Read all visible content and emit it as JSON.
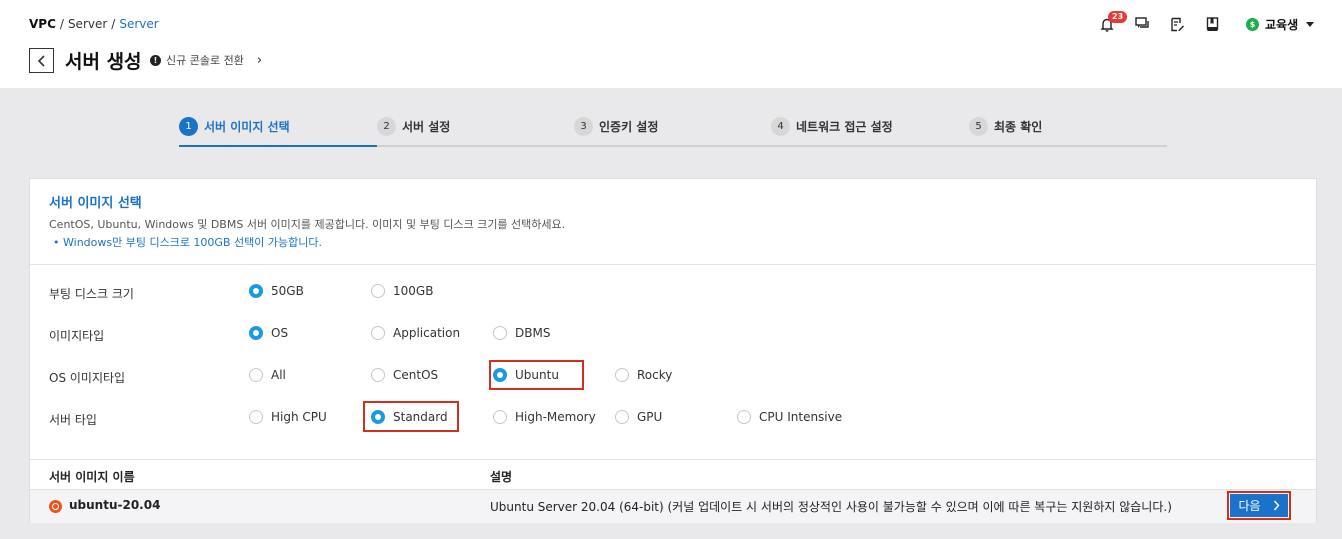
{
  "breadcrumb": [
    "VPC",
    "Server",
    "Server"
  ],
  "header": {
    "title": "서버 생성",
    "switch_console": "신규 콘솔로 전환",
    "notification_count": "23",
    "user_name": "교육생",
    "user_coin": "$"
  },
  "steps": [
    {
      "num": "1",
      "label": "서버 이미지 선택"
    },
    {
      "num": "2",
      "label": "서버 설정"
    },
    {
      "num": "3",
      "label": "인증키 설정"
    },
    {
      "num": "4",
      "label": "네트워크 접근 설정"
    },
    {
      "num": "5",
      "label": "최종 확인"
    }
  ],
  "section": {
    "title": "서버 이미지 선택",
    "description": "CentOS, Ubuntu, Windows 및 DBMS 서버 이미지를 제공합니다. 이미지 및 부팅 디스크 크기를 선택하세요.",
    "note": "Windows만 부팅 디스크로 100GB 선택이 가능합니다."
  },
  "form": {
    "boot_disk": {
      "label": "부팅 디스크 크기",
      "options": [
        "50GB",
        "100GB"
      ],
      "selected": "50GB"
    },
    "image_type": {
      "label": "이미지타입",
      "options": [
        "OS",
        "Application",
        "DBMS"
      ],
      "selected": "OS"
    },
    "os_image_type": {
      "label": "OS 이미지타입",
      "options": [
        "All",
        "CentOS",
        "Ubuntu",
        "Rocky"
      ],
      "selected": "Ubuntu"
    },
    "server_type": {
      "label": "서버 타입",
      "options": [
        "High CPU",
        "Standard",
        "High-Memory",
        "GPU",
        "CPU Intensive"
      ],
      "selected": "Standard"
    }
  },
  "table": {
    "headers": [
      "서버 이미지 이름",
      "설명"
    ],
    "rows": [
      {
        "name": "ubuntu-20.04",
        "description": "Ubuntu Server 20.04 (64-bit) (커널 업데이트 시 서버의 정상적인 사용이 불가능할 수 있으며 이에 따른 복구는 지원하지 않습니다.)",
        "action": "다음"
      }
    ]
  },
  "colors": {
    "accent": "#1a73c8",
    "radio_on": "#1a9be0",
    "highlight": "#d0311f"
  }
}
